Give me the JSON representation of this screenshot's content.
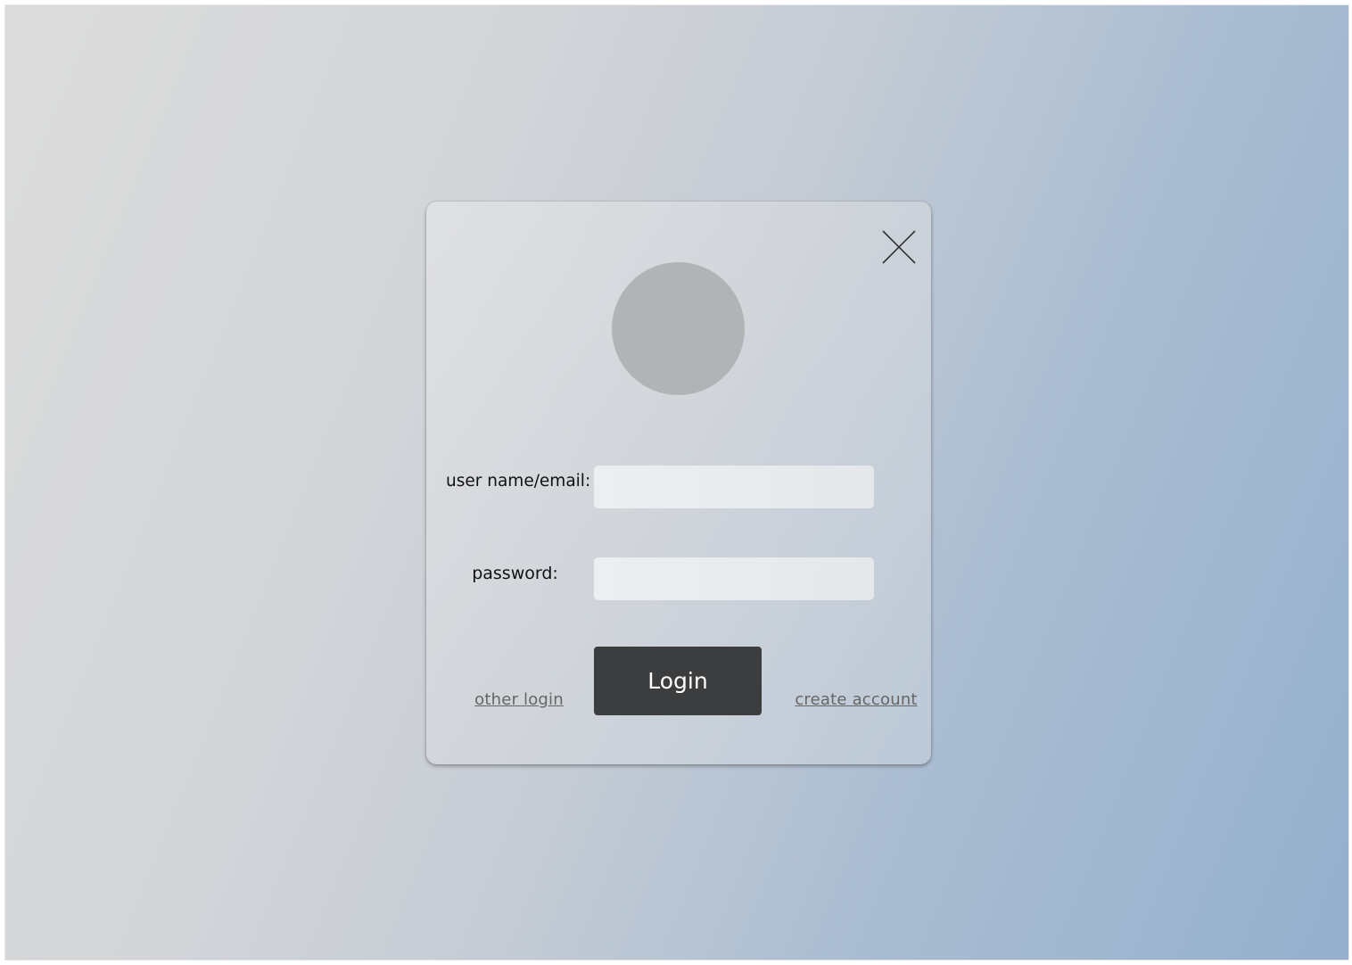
{
  "login_dialog": {
    "user_label": "user name/email:",
    "user_value": "",
    "password_label": "password:",
    "password_value": "",
    "login_label": "Login",
    "other_login_label": "other login",
    "create_account_label": "create account",
    "close_icon": "close-icon",
    "avatar_color": "#b2b3b5",
    "button_color": "#3c3d3f"
  }
}
